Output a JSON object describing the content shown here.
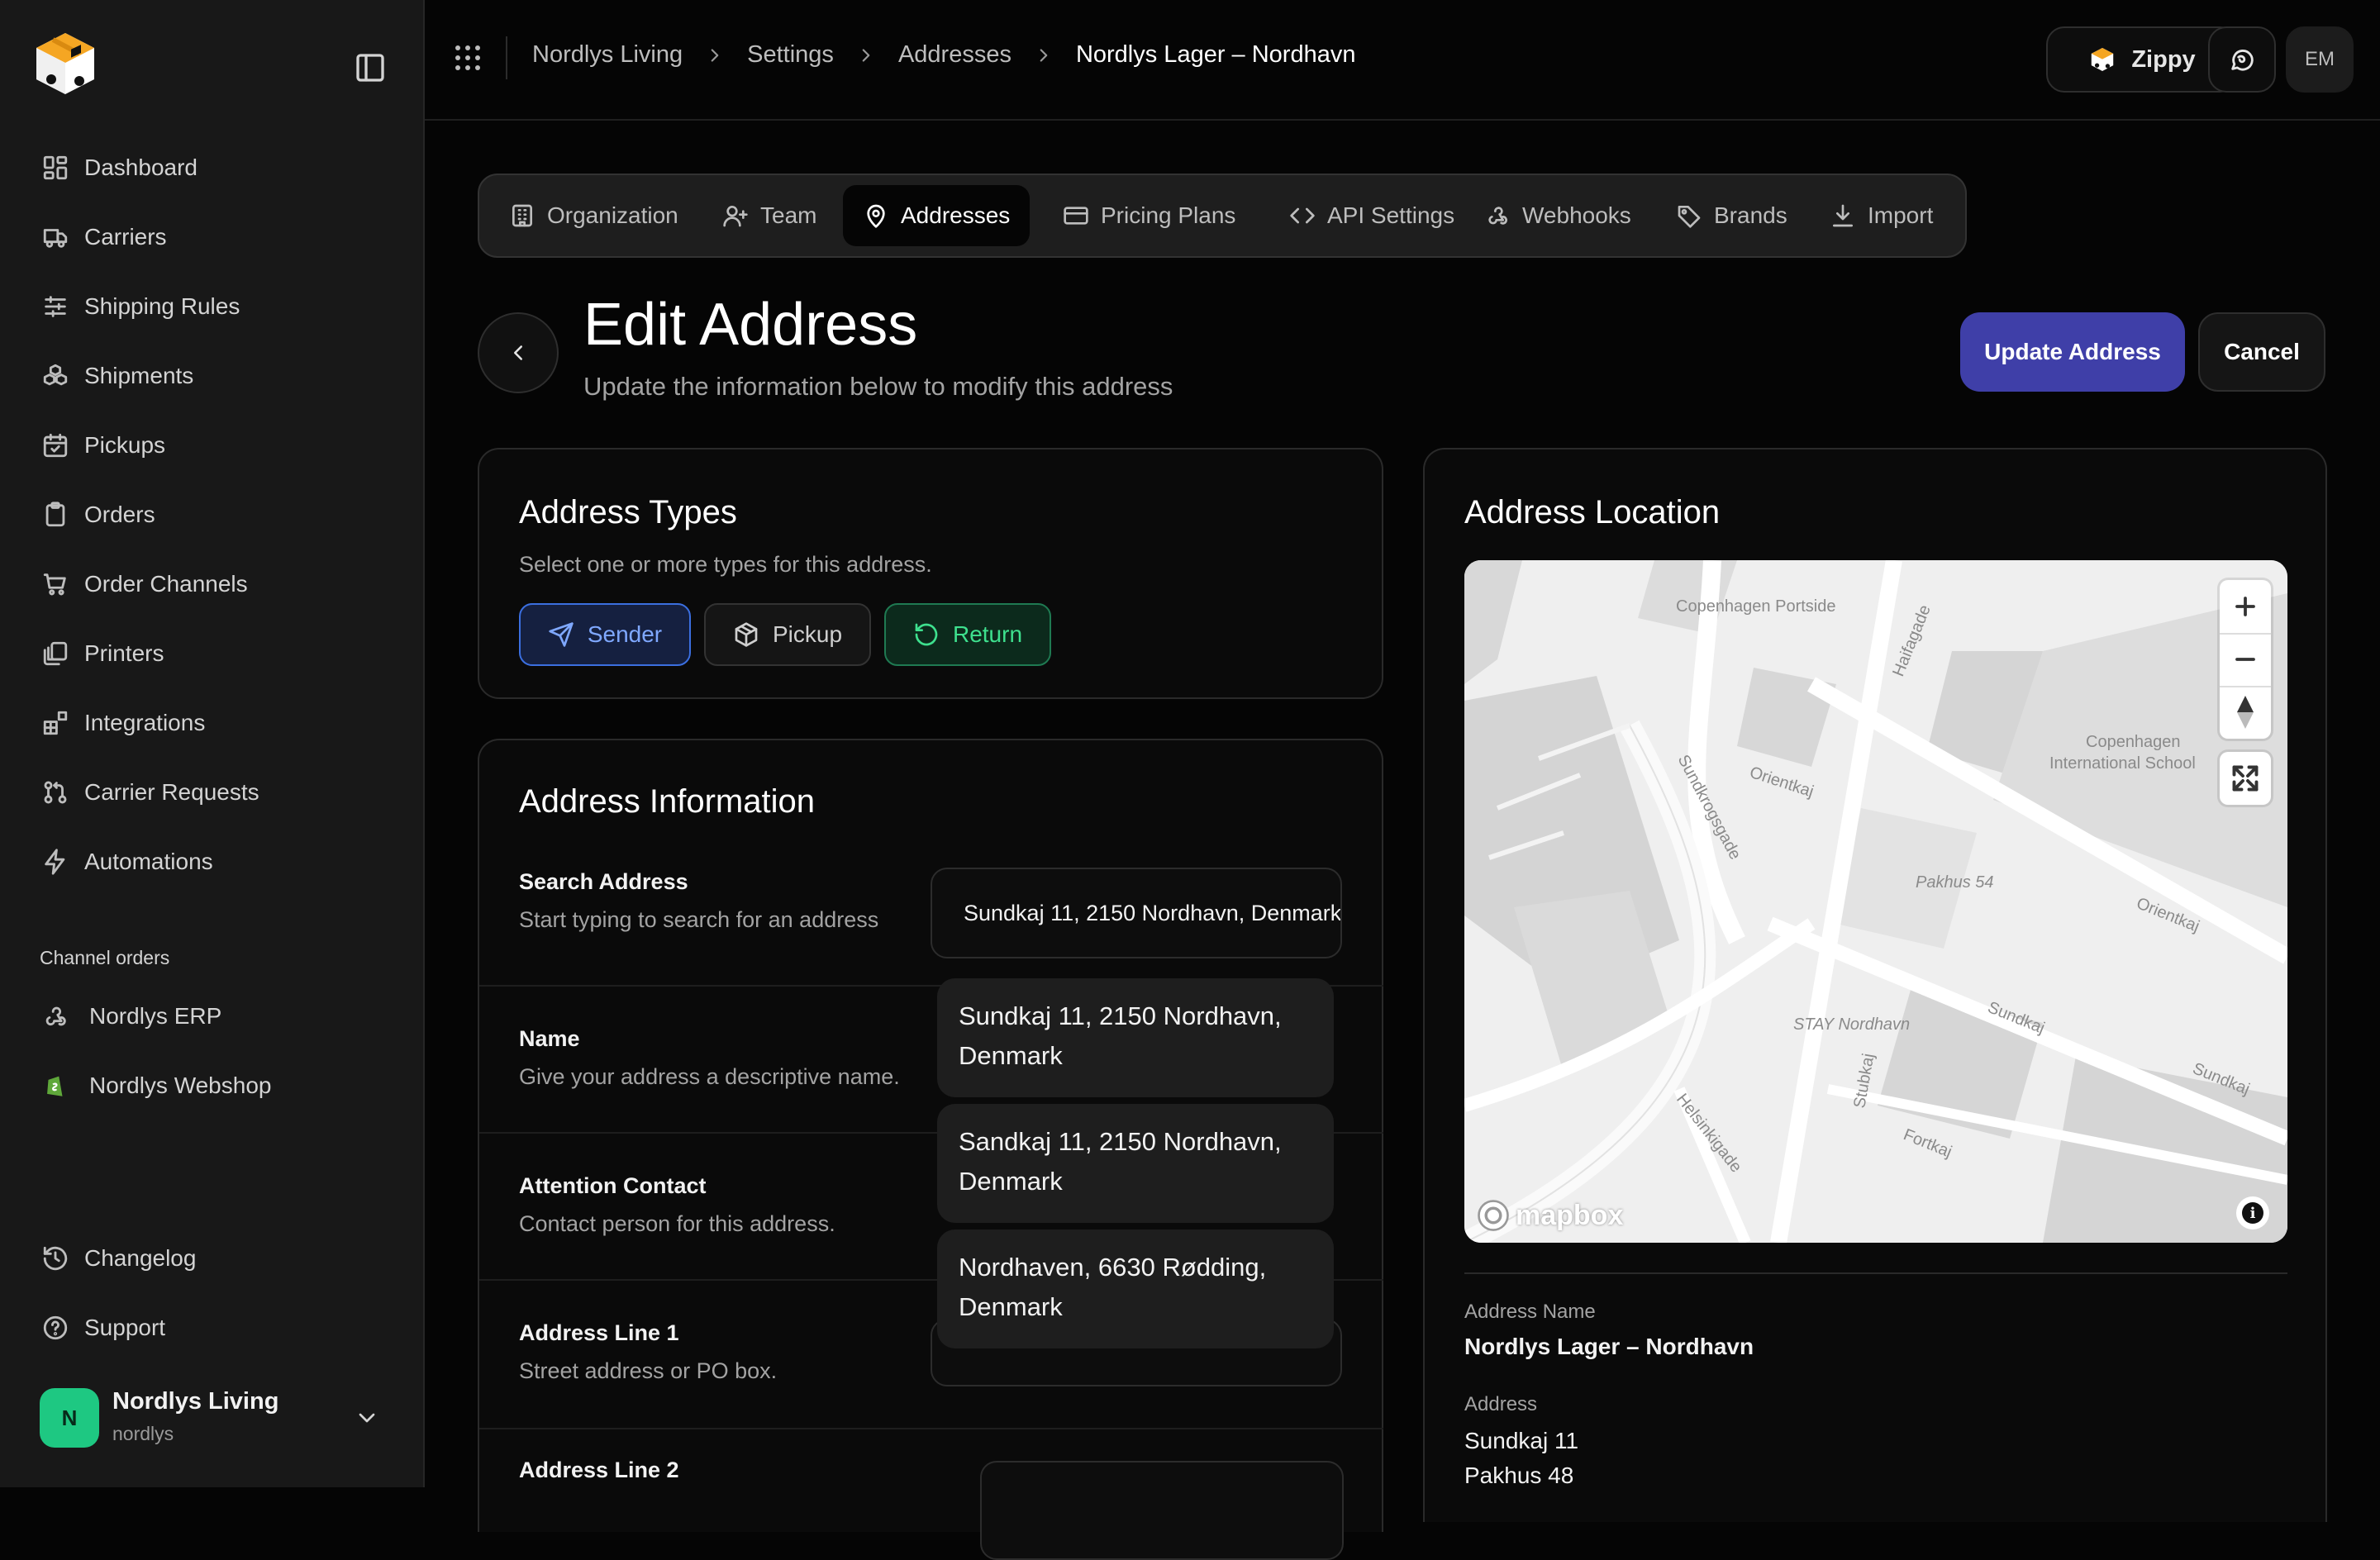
{
  "sidebar": {
    "nav": [
      {
        "label": "Dashboard",
        "icon": "dashboard-icon"
      },
      {
        "label": "Carriers",
        "icon": "truck-icon"
      },
      {
        "label": "Shipping Rules",
        "icon": "sliders-icon"
      },
      {
        "label": "Shipments",
        "icon": "boxes-icon"
      },
      {
        "label": "Pickups",
        "icon": "calendar-check-icon"
      },
      {
        "label": "Orders",
        "icon": "clipboard-icon"
      },
      {
        "label": "Order Channels",
        "icon": "cart-icon"
      },
      {
        "label": "Printers",
        "icon": "copy-icon"
      },
      {
        "label": "Integrations",
        "icon": "blocks-icon"
      },
      {
        "label": "Carrier Requests",
        "icon": "git-pull-request-icon"
      },
      {
        "label": "Automations",
        "icon": "zap-icon"
      }
    ],
    "channel_section_label": "Channel orders",
    "channels": [
      {
        "label": "Nordlys ERP",
        "icon": "webhook-icon"
      },
      {
        "label": "Nordlys Webshop",
        "icon": "shopify-icon"
      }
    ],
    "footer": [
      {
        "label": "Changelog",
        "icon": "history-icon"
      },
      {
        "label": "Support",
        "icon": "help-circle-icon"
      }
    ],
    "org": {
      "initial": "N",
      "name": "Nordlys Living",
      "slug": "nordlys"
    }
  },
  "topbar": {
    "breadcrumbs": [
      "Nordlys Living",
      "Settings",
      "Addresses",
      "Nordlys Lager – Nordhavn"
    ],
    "zippy_label": "Zippy",
    "avatar_initials": "EM"
  },
  "tabs": [
    {
      "label": "Organization",
      "icon": "building-icon"
    },
    {
      "label": "Team",
      "icon": "user-plus-icon"
    },
    {
      "label": "Addresses",
      "icon": "map-pin-icon",
      "active": true
    },
    {
      "label": "Pricing Plans",
      "icon": "credit-card-icon"
    },
    {
      "label": "API Settings",
      "icon": "code-icon"
    },
    {
      "label": "Webhooks",
      "icon": "webhook-icon"
    },
    {
      "label": "Brands",
      "icon": "tag-icon"
    },
    {
      "label": "Import",
      "icon": "download-icon"
    }
  ],
  "header": {
    "title": "Edit Address",
    "subtitle": "Update the information below to modify this address",
    "update_label": "Update Address",
    "cancel_label": "Cancel"
  },
  "address_types": {
    "title": "Address Types",
    "description": "Select one or more types for this address.",
    "types": [
      {
        "label": "Sender",
        "selected": true,
        "color": "#3b6fe0"
      },
      {
        "label": "Pickup",
        "selected": false,
        "color": "#cfcfcf"
      },
      {
        "label": "Return",
        "selected": true,
        "color": "#3ee08e"
      }
    ]
  },
  "address_info": {
    "title": "Address Information",
    "search": {
      "label": "Search Address",
      "help": "Start typing to search for an address",
      "value": "Sundkaj 11, 2150 Nordhavn, Denmark"
    },
    "name": {
      "label": "Name",
      "help": "Give your address a descriptive name."
    },
    "attention": {
      "label": "Attention Contact",
      "help": "Contact person for this address."
    },
    "line1": {
      "label": "Address Line 1",
      "help": "Street address or PO box."
    },
    "line2": {
      "label": "Address Line 2"
    },
    "suggestions": [
      "Sundkaj 11, 2150 Nordhavn, Denmark",
      "Sandkaj 11, 2150 Nordhavn, Denmark",
      "Nordhaven, 6630 Rødding, Denmark"
    ]
  },
  "location": {
    "title": "Address Location",
    "map_labels": [
      "Copenhagen Portside",
      "Haifagade",
      "Sundkrogsgade",
      "Orientkaj",
      "Copenhagen",
      "International School",
      "Pakhus 54",
      "Orientkaj",
      "Sundkaj",
      "STAY Nordhavn",
      "Stubkaj",
      "Sundkaj",
      "Helsinkigade",
      "Fortkaj"
    ],
    "mapbox_label": "mapbox",
    "address_name_label": "Address Name",
    "address_name": "Nordlys Lager – Nordhavn",
    "address_label": "Address",
    "address_lines": [
      "Sundkaj 11",
      "Pakhus 48"
    ]
  },
  "colors": {
    "accent": "#3f3fa8",
    "sender": "#3b6fe0",
    "return": "#1ec882",
    "logo": "#f5a623"
  }
}
